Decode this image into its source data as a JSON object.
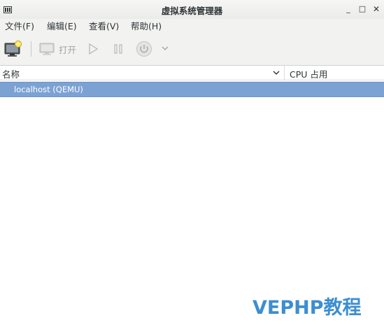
{
  "window": {
    "title": "虚拟系统管理器",
    "controls": {
      "minimize": "_",
      "maximize": "□",
      "close": "✕"
    }
  },
  "menubar": {
    "items": [
      {
        "label": "文件(F)"
      },
      {
        "label": "编辑(E)"
      },
      {
        "label": "查看(V)"
      },
      {
        "label": "帮助(H)"
      }
    ]
  },
  "toolbar": {
    "new_vm_icon": "new-vm-icon",
    "open_label": "打开",
    "open_icon": "monitor-icon",
    "run_icon": "play-icon",
    "pause_icon": "pause-icon",
    "shutdown_icon": "power-icon",
    "shutdown_menu_icon": "chevron-down-icon",
    "disabled_color": "#a3a5a2"
  },
  "columns": {
    "name": "名称",
    "cpu": "CPU 占用"
  },
  "connections": [
    {
      "label": "localhost (QEMU)",
      "selected": true
    }
  ],
  "colors": {
    "selection": "#7ca2d4",
    "watermark": "#3d8ed0"
  },
  "watermark": "VEPHP教程"
}
